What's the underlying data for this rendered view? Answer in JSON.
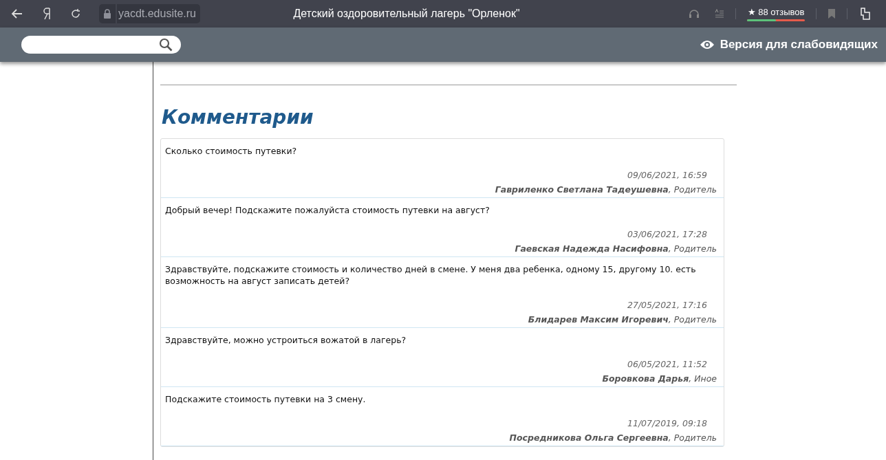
{
  "browser": {
    "url": "yacdt.edusite.ru",
    "title": "Детский оздоровительный лагерь \"Орленок\"",
    "reviews": {
      "star": "★",
      "label": "88 отзывов",
      "level": 0.5
    }
  },
  "site_header": {
    "accessibility_link": "Версия для слабовидящих"
  },
  "comments_title": "Комментарии",
  "comments": [
    {
      "text": "Сколько стоимость путевки?",
      "date": "09/06/2021, 16:59",
      "author": "**Гавриленко Светлана Тадеушевна**, Родитель"
    },
    {
      "text": "Добрый вечер! Подскажите пожалуйста стоимость путевки на август?",
      "date": "03/06/2021, 17:28",
      "author": "**Гаевская Надежда Насифовна**, Родитель"
    },
    {
      "text": "Здравствуйте, подскажите стоимость и количество дней в смене. У меня два ребенка, одному 15, другому 10. есть возможность на август записать детей?",
      "date": "27/05/2021, 17:16",
      "author": "**Блидарев Максим Игоревич**, Родитель"
    },
    {
      "text": "Здравствуйте, можно устроиться вожатой в лагерь?",
      "date": "06/05/2021, 11:52",
      "author": "**Боровкова Дарья**, Иное"
    },
    {
      "text": "Подскажите стоимость путевки на 3 смену.",
      "date": "11/07/2019, 09:18",
      "author": "**Посредникова Ольга Сергеевна**, Родитель"
    }
  ]
}
